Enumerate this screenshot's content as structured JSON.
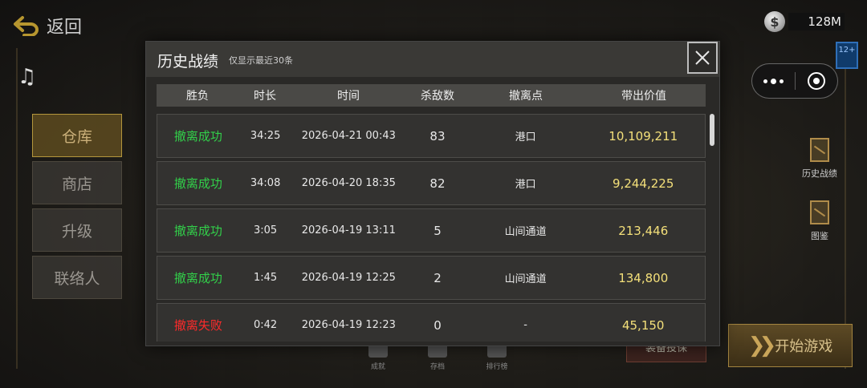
{
  "header": {
    "back_label": "返回"
  },
  "side_menu": [
    {
      "label": "仓库",
      "active": true
    },
    {
      "label": "商店",
      "active": false
    },
    {
      "label": "升级",
      "active": false
    },
    {
      "label": "联络人",
      "active": false
    }
  ],
  "currency": {
    "symbol": "$",
    "amount": "128M"
  },
  "age_rating": "12+",
  "right_tools": [
    {
      "label": "历史战绩",
      "icon": "scroll-icon"
    },
    {
      "label": "图鉴",
      "icon": "codex-icon"
    }
  ],
  "start_button": {
    "label": "开始游戏"
  },
  "equip_button": {
    "label": "装备投保"
  },
  "bottom_bar": [
    {
      "label": "成就"
    },
    {
      "label": "存档"
    },
    {
      "label": "排行榜"
    }
  ],
  "modal": {
    "title": "历史战绩",
    "subtitle": "仅显示最近30条",
    "columns": [
      "胜负",
      "时长",
      "时间",
      "杀敌数",
      "撤离点",
      "带出价值"
    ],
    "rows": [
      {
        "result": "撤离成功",
        "status": "success",
        "duration": "34:25",
        "time": "2026-04-21 00:43",
        "kills": "83",
        "extract": "港口",
        "value": "10,109,211"
      },
      {
        "result": "撤离成功",
        "status": "success",
        "duration": "34:08",
        "time": "2026-04-20 18:35",
        "kills": "82",
        "extract": "港口",
        "value": "9,244,225"
      },
      {
        "result": "撤离成功",
        "status": "success",
        "duration": "3:05",
        "time": "2026-04-19 13:11",
        "kills": "5",
        "extract": "山间通道",
        "value": "213,446"
      },
      {
        "result": "撤离成功",
        "status": "success",
        "duration": "1:45",
        "time": "2026-04-19 12:25",
        "kills": "2",
        "extract": "山间通道",
        "value": "134,800"
      },
      {
        "result": "撤离失败",
        "status": "fail",
        "duration": "0:42",
        "time": "2026-04-19 12:23",
        "kills": "0",
        "extract": "-",
        "value": "45,150"
      }
    ]
  },
  "colors": {
    "success": "#32d04a",
    "fail": "#ff2a2a",
    "value": "#f4e07a"
  }
}
